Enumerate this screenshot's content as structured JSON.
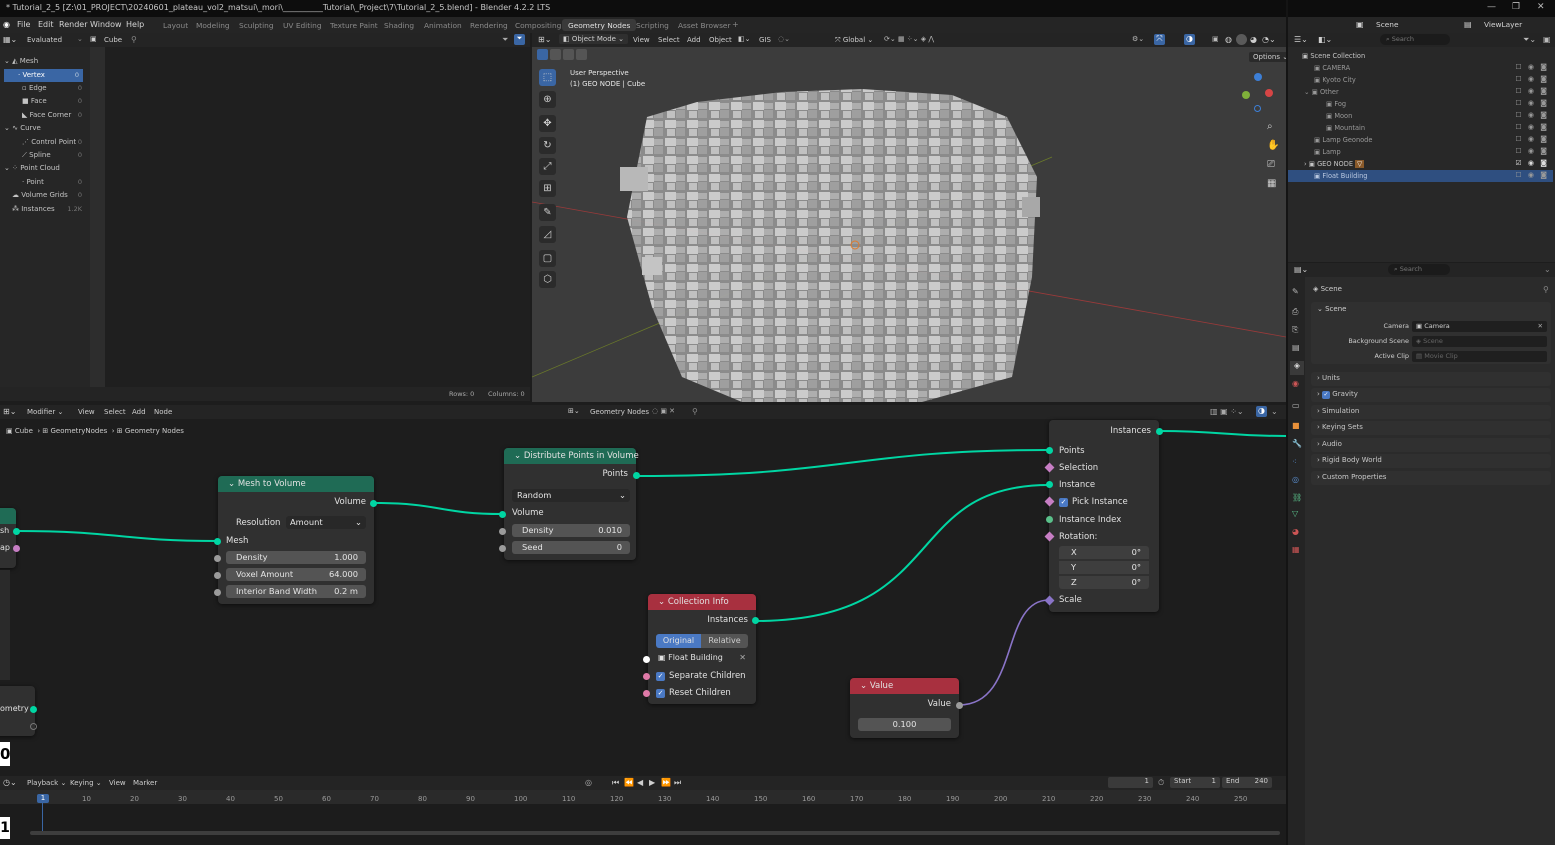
{
  "window": {
    "title": "* Tutorial_2_5 [Z:\\01_PROJECT\\20240601_plateau_vol2_matsui\\_mori\\__________Tutorial\\_Project\\7\\Tutorial_2_5.blend] - Blender 4.2.2 LTS"
  },
  "menu": {
    "items": [
      "File",
      "Edit",
      "Render",
      "Window",
      "Help"
    ]
  },
  "workspaces": [
    "Layout",
    "Modeling",
    "Sculpting",
    "UV Editing",
    "Texture Paint",
    "Shading",
    "Animation",
    "Rendering",
    "Compositing",
    "Geometry Nodes",
    "Scripting",
    "Asset Browser"
  ],
  "topright": {
    "scene": "Scene",
    "viewlayer": "ViewLayer"
  },
  "spreadsheet": {
    "mode": "Evaluated",
    "object": "Cube",
    "rows": [
      {
        "label": "Mesh",
        "count": "",
        "indent": 0,
        "selected": false,
        "icon": "mesh-icon"
      },
      {
        "label": "Vertex",
        "count": "0",
        "indent": 1,
        "selected": true,
        "icon": "vertex-icon"
      },
      {
        "label": "Edge",
        "count": "0",
        "indent": 1,
        "selected": false,
        "icon": "edge-icon"
      },
      {
        "label": "Face",
        "count": "0",
        "indent": 1,
        "selected": false,
        "icon": "face-icon"
      },
      {
        "label": "Face Corner",
        "count": "0",
        "indent": 1,
        "selected": false,
        "icon": "face-corner-icon"
      },
      {
        "label": "Curve",
        "count": "",
        "indent": 0,
        "selected": false,
        "icon": "curve-icon"
      },
      {
        "label": "Control Point",
        "count": "0",
        "indent": 1,
        "selected": false,
        "icon": "control-point-icon"
      },
      {
        "label": "Spline",
        "count": "0",
        "indent": 1,
        "selected": false,
        "icon": "spline-icon"
      },
      {
        "label": "Point Cloud",
        "count": "",
        "indent": 0,
        "selected": false,
        "icon": "point-cloud-icon"
      },
      {
        "label": "Point",
        "count": "0",
        "indent": 1,
        "selected": false,
        "icon": "point-icon"
      },
      {
        "label": "Volume Grids",
        "count": "0",
        "indent": 0,
        "selected": false,
        "icon": "volume-icon"
      },
      {
        "label": "Instances",
        "count": "1.2K",
        "indent": 0,
        "selected": false,
        "icon": "instances-icon"
      }
    ],
    "status": {
      "rows": "Rows: 0",
      "columns": "Columns: 0"
    }
  },
  "viewport": {
    "mode": "Object Mode",
    "menus": [
      "View",
      "Select",
      "Add",
      "Object"
    ],
    "gis": "GIS",
    "transform": "Global",
    "options": "Options",
    "info_line1": "User Perspective",
    "info_line2": "(1) GEO NODE | Cube"
  },
  "outliner": {
    "search_placeholder": "Search",
    "rows": [
      {
        "label": "Scene Collection",
        "indent": 0,
        "selected": false
      },
      {
        "label": "CAMERA",
        "indent": 1,
        "selected": false
      },
      {
        "label": "Kyoto City",
        "indent": 1,
        "selected": false
      },
      {
        "label": "Other",
        "indent": 1,
        "selected": false
      },
      {
        "label": "Fog",
        "indent": 2,
        "selected": false
      },
      {
        "label": "Moon",
        "indent": 2,
        "selected": false
      },
      {
        "label": "Mountain",
        "indent": 2,
        "selected": false
      },
      {
        "label": "Lamp Geonode",
        "indent": 1,
        "selected": false
      },
      {
        "label": "Lamp",
        "indent": 1,
        "selected": false
      },
      {
        "label": "GEO NODE",
        "indent": 1,
        "selected": false
      },
      {
        "label": "Float Building",
        "indent": 1,
        "selected": true
      }
    ]
  },
  "properties": {
    "search_placeholder": "Search",
    "context": "Scene",
    "section": "Scene",
    "camera_label": "Camera",
    "camera_value": "Camera",
    "bg_label": "Background Scene",
    "bg_placeholder": "Scene",
    "clip_label": "Active Clip",
    "clip_placeholder": "Movie Clip",
    "panels": [
      "Units",
      "Gravity",
      "Simulation",
      "Keying Sets",
      "Audio",
      "Rigid Body World",
      "Custom Properties"
    ]
  },
  "node_editor": {
    "menus": [
      "Modifier",
      "View",
      "Select",
      "Add",
      "Node"
    ],
    "tree_name": "Geometry Nodes",
    "breadcrumb": [
      "Cube",
      "GeometryNodes",
      "Geometry Nodes"
    ]
  },
  "nodes": {
    "mesh_to_volume": {
      "title": "Mesh to Volume",
      "out_volume": "Volume",
      "resolution_label": "Resolution",
      "resolution_value": "Amount",
      "in_mesh": "Mesh",
      "density_label": "Density",
      "density_value": "1.000",
      "voxel_label": "Voxel Amount",
      "voxel_value": "64.000",
      "band_label": "Interior Band Width",
      "band_value": "0.2 m"
    },
    "distribute": {
      "title": "Distribute Points in Volume",
      "out_points": "Points",
      "mode": "Random",
      "in_volume": "Volume",
      "density_label": "Density",
      "density_value": "0.010",
      "seed_label": "Seed",
      "seed_value": "0"
    },
    "collection_info": {
      "title": "Collection Info",
      "out_instances": "Instances",
      "original": "Original",
      "relative": "Relative",
      "collection": "Float Building",
      "separate": "Separate Children",
      "reset": "Reset Children"
    },
    "value": {
      "title": "Value",
      "out_value": "Value",
      "value": "0.100"
    },
    "instance_on_points": {
      "out_instances": "Instances",
      "points": "Points",
      "selection": "Selection",
      "instance": "Instance",
      "pick": "Pick Instance",
      "index": "Instance Index",
      "rotation": "Rotation:",
      "x_label": "X",
      "x_value": "0°",
      "y_label": "Y",
      "y_value": "0°",
      "z_label": "Z",
      "z_value": "0°",
      "scale": "Scale"
    },
    "left_partial": {
      "a": "sh",
      "b": "ap",
      "c": "ometry"
    }
  },
  "timeline": {
    "menus": [
      "Playback",
      "Keying",
      "View",
      "Marker"
    ],
    "current_frame": "1",
    "start_label": "Start",
    "start_value": "1",
    "end_label": "End",
    "end_value": "240",
    "ticks": [
      "10",
      "20",
      "30",
      "40",
      "50",
      "60",
      "70",
      "80",
      "90",
      "100",
      "110",
      "120",
      "130",
      "140",
      "150",
      "160",
      "170",
      "180",
      "190",
      "200",
      "210",
      "220",
      "230",
      "240",
      "250"
    ],
    "playhead": "1",
    "side_big": "0",
    "side_big2": "1"
  },
  "colors": {
    "accent": "#3a66a4",
    "geometry": "#00d6a3",
    "collection_header": "#a8303f",
    "node_header_green": "#1f6b55"
  }
}
